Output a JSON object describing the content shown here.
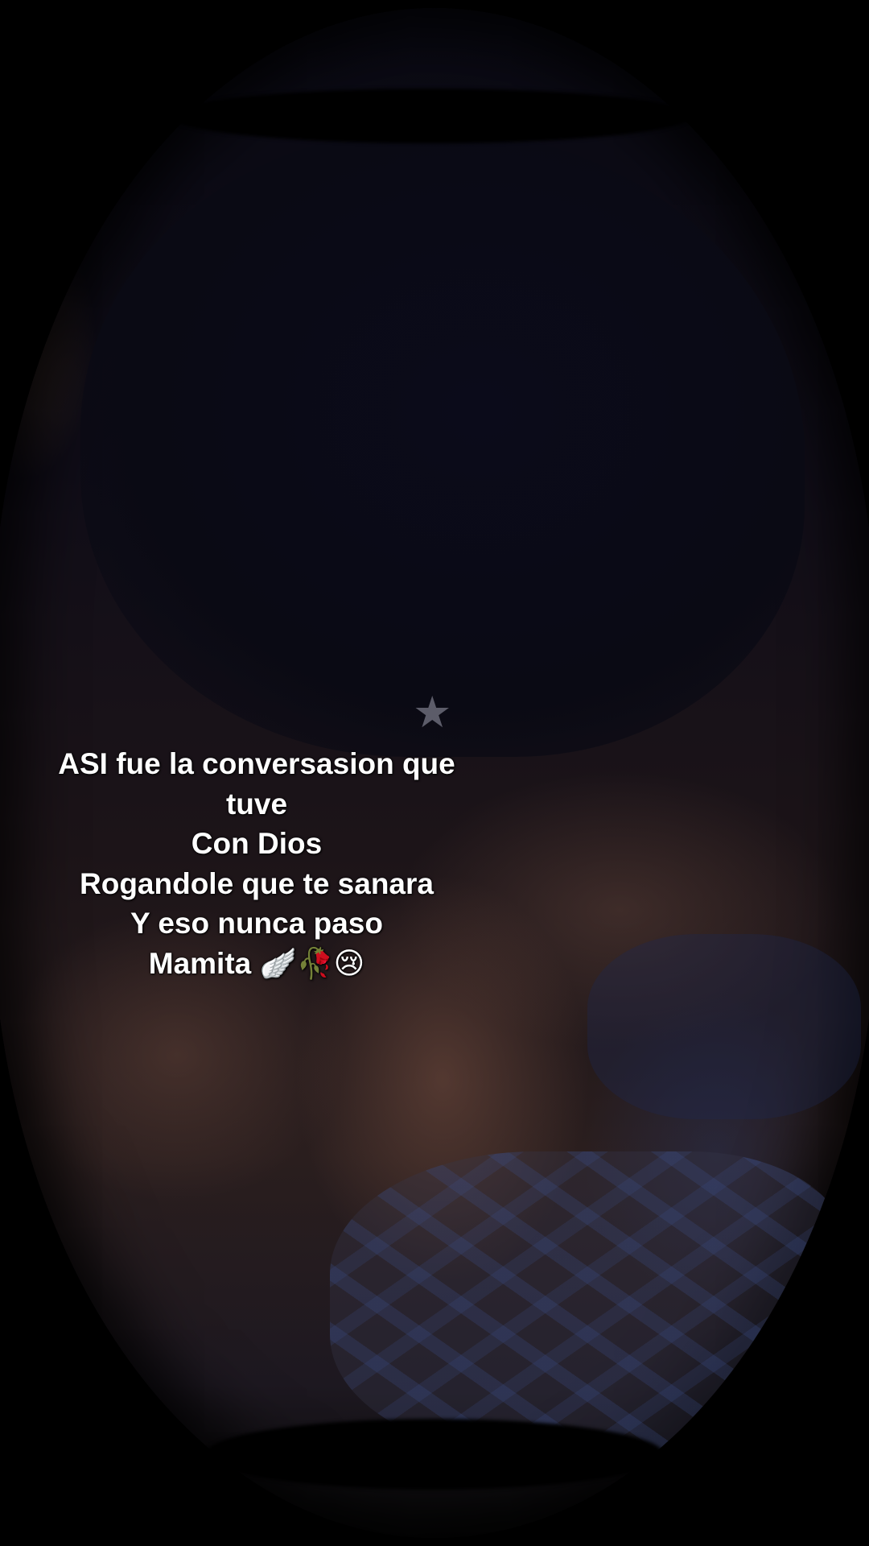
{
  "caption": {
    "lines": [
      "ASI fue la conversasion que",
      "tuve",
      "Con Dios",
      "Rogandole que te sanara",
      "Y eso nunca paso"
    ],
    "last_line_text": "Mamita",
    "emojis": "🪽🥀😢"
  },
  "overlay": {
    "star_glyph": "★"
  },
  "colors": {
    "caption_text": "#ffffff",
    "background": "#000000"
  }
}
